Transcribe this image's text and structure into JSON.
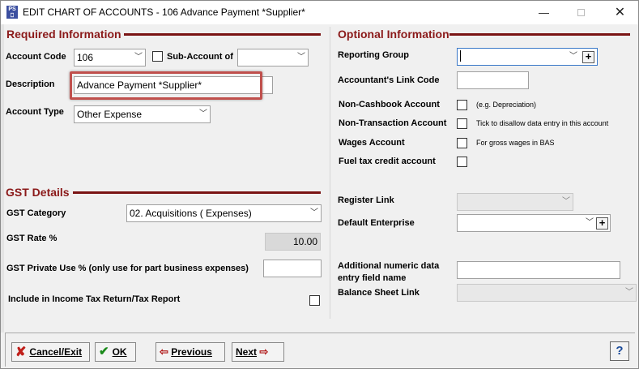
{
  "window": {
    "app_icon": "ps-app-icon",
    "title": "EDIT CHART OF ACCOUNTS - 106 Advance Payment *Supplier*",
    "minimize_glyph": "—",
    "close_glyph": "✕"
  },
  "required": {
    "title": "Required Information",
    "account_code_label": "Account Code",
    "account_code_value": "106",
    "sub_account_label": "Sub-Account of",
    "sub_account_value": "",
    "description_label": "Description",
    "description_value": "Advance Payment *Supplier*",
    "account_type_label": "Account Type",
    "account_type_value": "Other Expense"
  },
  "gst": {
    "title": "GST Details",
    "category_label": "GST Category",
    "category_value": "02. Acquisitions ( Expenses)",
    "rate_label": "GST Rate %",
    "rate_value": "10.00",
    "private_use_label": "GST Private Use % (only use for part business expenses)",
    "private_use_value": "",
    "include_label": "Include in Income Tax Return/Tax Report"
  },
  "optional": {
    "title": "Optional Information",
    "reporting_group_label": "Reporting Group",
    "reporting_group_value": "",
    "accountant_link_label": "Accountant's Link Code",
    "accountant_link_value": "",
    "non_cashbook_label": "Non-Cashbook Account",
    "non_cashbook_hint": "(e.g. Depreciation)",
    "non_transaction_label": "Non-Transaction Account",
    "non_transaction_hint": "Tick to disallow data entry in this account",
    "wages_label": "Wages Account",
    "wages_hint": "For gross wages in BAS",
    "fuel_tax_label": "Fuel tax credit account",
    "register_link_label": "Register Link",
    "register_link_value": "",
    "default_enterprise_label": "Default Enterprise",
    "default_enterprise_value": "",
    "additional_field_label_1": "Additional numeric data",
    "additional_field_label_2": "entry field name",
    "additional_field_value": "",
    "balance_sheet_label": "Balance Sheet Link",
    "balance_sheet_value": ""
  },
  "buttons": {
    "cancel_label": "Cancel/Exit",
    "ok_label": "OK",
    "previous_label": "Previous",
    "next_label": "Next",
    "help_label": "?"
  },
  "icons": {
    "dropdown": "chevron-down-icon",
    "plus": "plus-icon",
    "cancel": "red-x-icon",
    "ok": "green-check-icon",
    "previous": "left-arrow-icon",
    "next": "right-arrow-icon"
  },
  "colors": {
    "section_title": "#8b1a1a",
    "section_rule": "#7a1414",
    "highlight_box": "#c0504d"
  }
}
